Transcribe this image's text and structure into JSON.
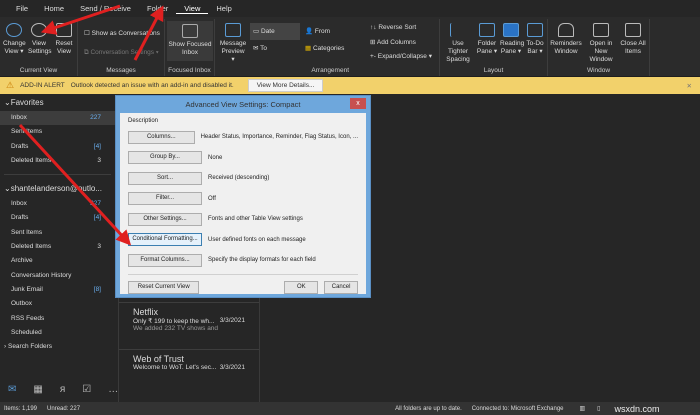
{
  "tabs": [
    "File",
    "Home",
    "Send / Receive",
    "Folder",
    "View",
    "Help"
  ],
  "ribbon": {
    "current_view": {
      "label": "Current View",
      "change_view": "Change View ▾",
      "view_settings": "View Settings",
      "reset_view": "Reset View"
    },
    "messages": {
      "label": "Messages",
      "show_as_conversations": "Show as Conversations",
      "conversation_settings": "Conversation Settings ▾"
    },
    "focused": {
      "label": "Focused Inbox",
      "show_focused": "Show Focused Inbox"
    },
    "arrangement": {
      "label": "Arrangement",
      "message_preview": "Message Preview ▾",
      "date": "Date",
      "from": "From",
      "to": "To",
      "categories": "Categories",
      "reverse_sort": "Reverse Sort",
      "add_columns": "Add Columns",
      "expand_collapse": "Expand/Collapse ▾"
    },
    "layout": {
      "label": "Layout",
      "tighter": "Use Tighter Spacing",
      "folder_pane": "Folder Pane ▾",
      "reading_pane": "Reading Pane ▾",
      "todo_bar": "To-Do Bar ▾"
    },
    "window": {
      "label": "Window",
      "reminders": "Reminders Window",
      "open_new": "Open in New Window",
      "close_all": "Close All Items"
    }
  },
  "alert": {
    "title": "ADD-IN ALERT",
    "message": "Outlook detected an issue with an add-in and disabled it.",
    "button": "View More Details..."
  },
  "sidebar": {
    "favorites": "Favorites",
    "fav_items": [
      {
        "label": "Inbox",
        "count": "227"
      },
      {
        "label": "Sent Items",
        "count": ""
      },
      {
        "label": "Drafts",
        "count": "[4]"
      },
      {
        "label": "Deleted Items",
        "count": "3"
      }
    ],
    "account": "shantelanderson@outlo...",
    "acct_items": [
      {
        "label": "Inbox",
        "count": "227"
      },
      {
        "label": "Drafts",
        "count": "[4]"
      },
      {
        "label": "Sent Items",
        "count": ""
      },
      {
        "label": "Deleted Items",
        "count": "3"
      },
      {
        "label": "Archive",
        "count": ""
      },
      {
        "label": "Conversation History",
        "count": ""
      },
      {
        "label": "Junk Email",
        "count": "[8]"
      },
      {
        "label": "Outbox",
        "count": ""
      },
      {
        "label": "RSS Feeds",
        "count": ""
      },
      {
        "label": "Scheduled",
        "count": ""
      }
    ],
    "search_folders": "Search Folders"
  },
  "messages": [
    {
      "from": "Netflix",
      "subject": "Only ₹ 199 to keep the wh...",
      "date": "3/3/2021",
      "preview": "We added 232 TV shows and"
    },
    {
      "from": "Web of Trust",
      "subject": "Welcome to WoT. Let's sec...",
      "date": "3/3/2021",
      "preview": ""
    }
  ],
  "dialog": {
    "title": "Advanced View Settings: Compact",
    "description": "Description",
    "rows": [
      {
        "button": "Columns...",
        "desc": "Header Status, Importance, Reminder, Flag Status, Icon, ..."
      },
      {
        "button": "Group By...",
        "desc": "None"
      },
      {
        "button": "Sort...",
        "desc": "Received (descending)"
      },
      {
        "button": "Filter...",
        "desc": "Off"
      },
      {
        "button": "Other Settings...",
        "desc": "Fonts and other Table View settings"
      },
      {
        "button": "Conditional Formatting...",
        "desc": "User defined fonts on each message"
      },
      {
        "button": "Format Columns...",
        "desc": "Specify the display formats for each field"
      }
    ],
    "reset": "Reset Current View",
    "ok": "OK",
    "cancel": "Cancel",
    "close": "x"
  },
  "status": {
    "items": "Items: 1,199",
    "unread": "Unread: 227",
    "sync": "All folders are up to date.",
    "connection": "Connected to: Microsoft Exchange"
  },
  "watermark": "wsxdn.com"
}
